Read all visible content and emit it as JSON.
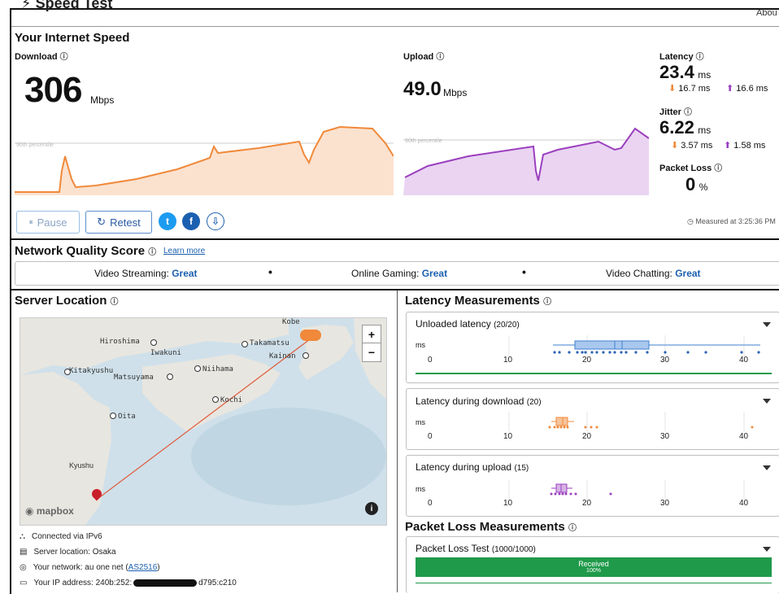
{
  "app": {
    "title": "Speed Test",
    "about": "Abou"
  },
  "speed": {
    "section_title": "Your Internet Speed",
    "download": {
      "label": "Download",
      "value": "306",
      "unit": "Mbps"
    },
    "upload": {
      "label": "Upload",
      "value": "49.0",
      "unit": "Mbps"
    },
    "percentile_label": "90th percentile",
    "latency": {
      "label": "Latency",
      "value": "23.4",
      "unit": "ms",
      "down": "16.7 ms",
      "up": "16.6 ms"
    },
    "jitter": {
      "label": "Jitter",
      "value": "6.22",
      "unit": "ms",
      "down": "3.57 ms",
      "up": "1.58 ms"
    },
    "packet_loss": {
      "label": "Packet Loss",
      "value": "0",
      "unit": "%"
    },
    "measured_at": "Measured at 3:25:36 PM"
  },
  "controls": {
    "pause": "Pause",
    "retest": "Retest"
  },
  "quality": {
    "title": "Network Quality Score",
    "learn_more": "Learn more",
    "items": [
      {
        "label": "Video Streaming:",
        "value": "Great"
      },
      {
        "label": "Online Gaming:",
        "value": "Great"
      },
      {
        "label": "Video Chatting:",
        "value": "Great"
      }
    ]
  },
  "server": {
    "title": "Server Location",
    "map_labels": [
      "Hiroshima",
      "Iwakuni",
      "Takamatsu",
      "Kobe",
      "Kainan",
      "Kitakyushu",
      "Matsuyama",
      "Niihama",
      "Kochi",
      "Oita",
      "Kyushu"
    ],
    "mapbox": "mapbox",
    "connected": "Connected via IPv6",
    "location": "Server location: Osaka",
    "network_prefix": "Your network: au one net (",
    "network_link": "AS2516",
    "network_suffix": ")",
    "ip": "Your IP address: 240b:252:",
    "ip_tail": "d795:c210"
  },
  "latency_measurements": {
    "title": "Latency Measurements",
    "unit": "ms",
    "ticks": [
      "0",
      "10",
      "20",
      "30",
      "40"
    ],
    "unloaded": {
      "label": "Unloaded latency",
      "count": "(20/20)"
    },
    "download": {
      "label": "Latency during download",
      "count": "(20)"
    },
    "upload": {
      "label": "Latency during upload",
      "count": "(15)"
    }
  },
  "packet_loss": {
    "title": "Packet Loss Measurements",
    "test_label": "Packet Loss Test",
    "count": "(1000/1000)",
    "received": "Received",
    "percent": "100%"
  },
  "colors": {
    "download": "#f0893a",
    "upload": "#9b3fbf",
    "unloaded": "#3f7fd0",
    "green": "#1f9a4a"
  }
}
